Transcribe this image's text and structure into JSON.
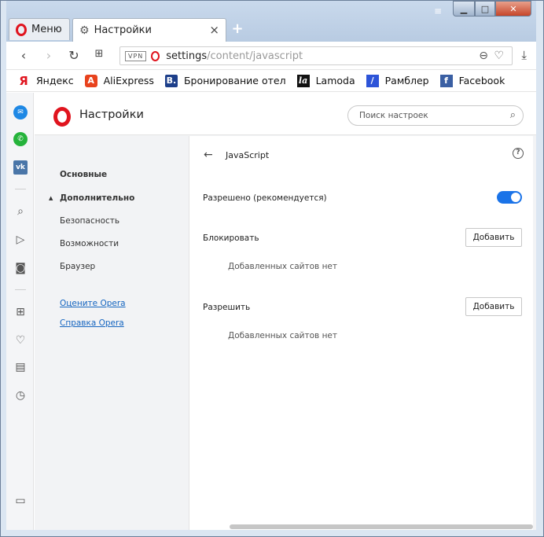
{
  "tabs": {
    "menu_label": "Меню",
    "active_tab_label": "Настройки",
    "close_symbol": "×",
    "new_tab_symbol": "+"
  },
  "window_controls": {
    "minimize": "▁",
    "maximize": "□",
    "close": "✕",
    "tray": "≡"
  },
  "address": {
    "vpn_badge": "VPN",
    "url_host": "settings",
    "url_path": "/content/javascript"
  },
  "bookmarks": [
    {
      "icon": "Я",
      "label": "Яндекс"
    },
    {
      "icon": "A",
      "label": "AliExpress"
    },
    {
      "icon": "B.",
      "label": "Бронирование отел"
    },
    {
      "icon": "la",
      "label": "Lamoda"
    },
    {
      "icon": "/",
      "label": "Рамблер"
    },
    {
      "icon": "f",
      "label": "Facebook"
    }
  ],
  "header": {
    "title": "Настройки",
    "search_placeholder": "Поиск настроек"
  },
  "settings_nav": {
    "basic": "Основные",
    "advanced": "Дополнительно",
    "security": "Безопасность",
    "features": "Возможности",
    "browser": "Браузер",
    "rate": "Оцените Opera",
    "help": "Справка Opera"
  },
  "panel": {
    "title": "JavaScript",
    "allowed_label": "Разрешено (рекомендуется)",
    "allowed_enabled": true,
    "block_label": "Блокировать",
    "block_add": "Добавить",
    "block_empty": "Добавленных сайтов нет",
    "allow_label": "Разрешить",
    "allow_add": "Добавить",
    "allow_empty": "Добавленных сайтов нет"
  },
  "colors": {
    "opera_red": "#e0141e",
    "toggle_blue": "#1a73e8",
    "link_blue": "#1565c0"
  }
}
